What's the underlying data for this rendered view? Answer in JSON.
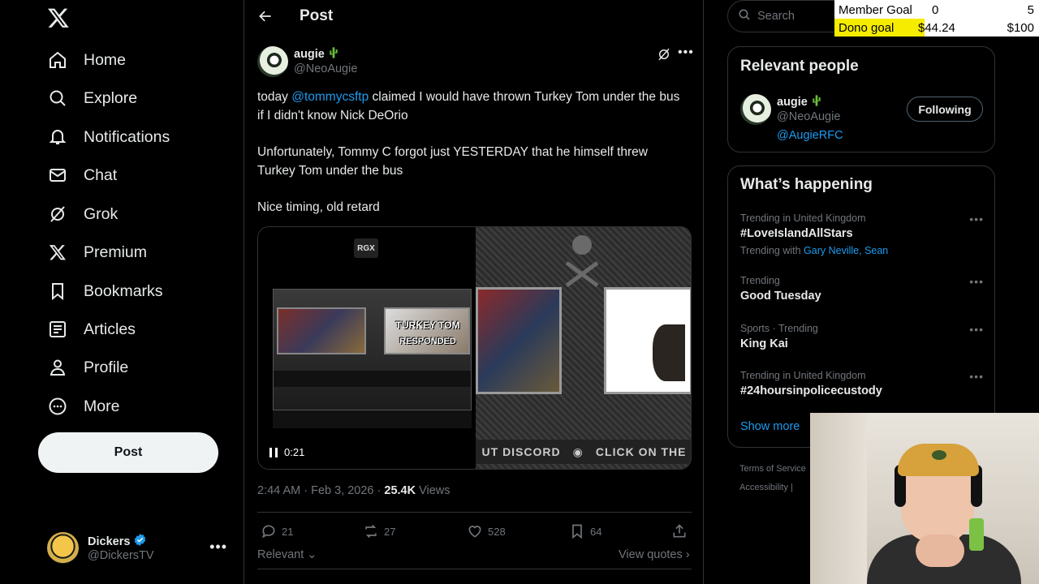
{
  "nav": {
    "items": [
      {
        "label": "Home",
        "icon": "home-icon"
      },
      {
        "label": "Explore",
        "icon": "search-icon"
      },
      {
        "label": "Notifications",
        "icon": "bell-icon"
      },
      {
        "label": "Chat",
        "icon": "mail-icon"
      },
      {
        "label": "Grok",
        "icon": "grok-icon"
      },
      {
        "label": "Premium",
        "icon": "x-logo-icon"
      },
      {
        "label": "Bookmarks",
        "icon": "bookmark-icon"
      },
      {
        "label": "Articles",
        "icon": "article-icon"
      },
      {
        "label": "Profile",
        "icon": "person-icon"
      },
      {
        "label": "More",
        "icon": "more-circle-icon"
      }
    ],
    "post_label": "Post"
  },
  "account": {
    "name": "Dickers",
    "handle": "@DickersTV"
  },
  "header": {
    "title": "Post"
  },
  "tweet": {
    "author_name": "augie",
    "author_handle": "@NeoAugie",
    "text_prefix": "today ",
    "mention": "@tommycsftp",
    "text_line1_rest": " claimed I would have thrown Turkey Tom under the bus if I didn't know Nick DeOrio",
    "paragraph2": "Unfortunately, Tommy C forgot just YESTERDAY that he himself threw Turkey Tom under the bus",
    "paragraph3": "Nice timing, old retard",
    "video_time": "0:21",
    "video_badge": "RGX",
    "video_text_turkey": "TURKEY TOM",
    "video_text_responded": "RESPONDED",
    "video_banner_left": "UT DISCORD",
    "video_banner_right": "CLICK ON THE",
    "timestamp": "2:44 AM · Feb 3, 2026 · ",
    "views_count": "25.4K",
    "views_label": " Views",
    "replies": "21",
    "reposts": "27",
    "likes": "528",
    "bookmarks": "64",
    "relevant_label": "Relevant",
    "view_quotes_label": "View quotes"
  },
  "search": {
    "placeholder": "Search"
  },
  "relevant_people": {
    "title": "Relevant people",
    "name": "augie",
    "handle": "@NeoAugie",
    "bio": "@AugieRFC",
    "button": "Following"
  },
  "happening": {
    "title": "What’s happening",
    "trends": [
      {
        "context": "Trending in United Kingdom",
        "name": "#LoveIslandAllStars",
        "with_label": "Trending with ",
        "with": "Gary Neville, Sean"
      },
      {
        "context": "Trending",
        "name": "Good Tuesday"
      },
      {
        "context": "Sports · Trending",
        "name": "King Kai"
      },
      {
        "context": "Trending in United Kingdom",
        "name": "#24hoursinpolicecustody"
      }
    ],
    "show_more": "Show more"
  },
  "footer": {
    "line1": "Terms of Service",
    "line2": "Accessibility"
  },
  "overlay": {
    "member_label": "Member Goal",
    "member_value": "0",
    "member_target": "5",
    "dono_label": "Dono goal",
    "dono_value": "$44.24",
    "dono_target": "$100",
    "dono_progress": 0.4424
  },
  "colors": {
    "accent": "#1d9bf0",
    "verified": "#1d9bf0",
    "cactus": "#6abf3b",
    "dono_fill": "#f5ec00"
  }
}
